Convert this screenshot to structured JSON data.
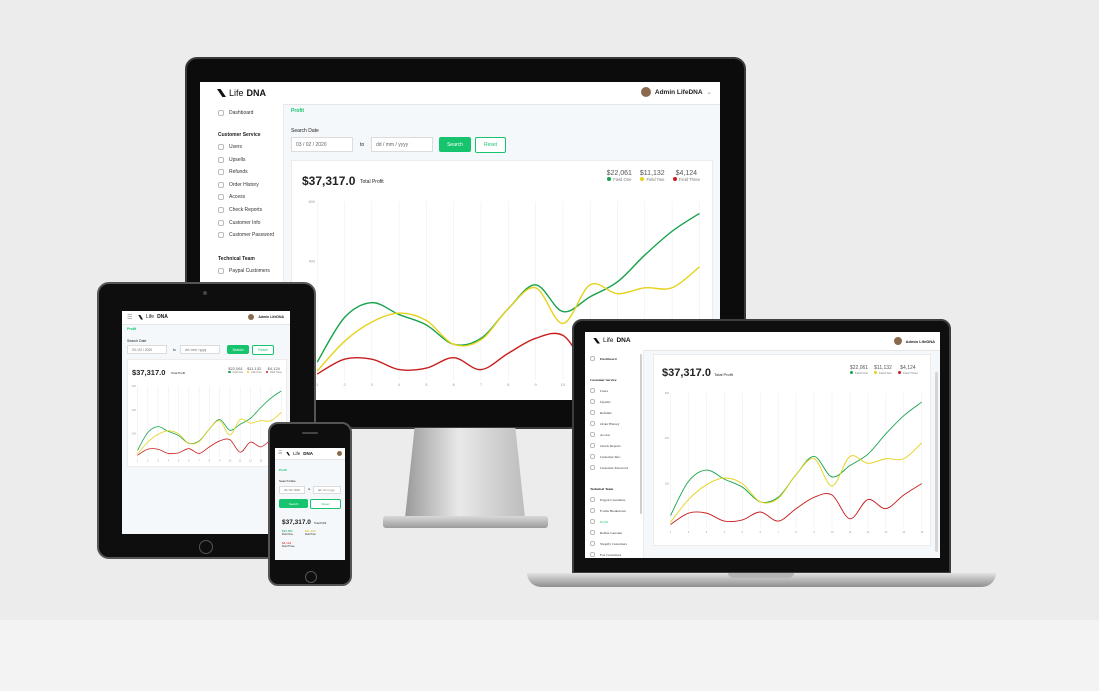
{
  "brand": {
    "prefix": "Life",
    "suffix": "DNA"
  },
  "user": {
    "name": "Admin LifeDNA"
  },
  "sidebar": {
    "dashboard": "Dashboard",
    "customer_service_title": "Customer Service",
    "customer_service_items": [
      "Users",
      "Upsells",
      "Refunds",
      "Order History",
      "Access",
      "Check Reports",
      "Customer Info",
      "Customer Password"
    ],
    "technical_team_title": "Technical Team",
    "technical_team_items": [
      "Paypal Customers",
      "Forms Breakdown",
      "Profit",
      "Refine Genome",
      "Shopify Customers",
      "Fax Customers"
    ]
  },
  "page": {
    "title": "Profit"
  },
  "filters": {
    "label": "Search Date",
    "from_value": "03 / 02 / 2020",
    "to_label": "to",
    "to_placeholder": "dd / mm / yyyy",
    "search_label": "Search",
    "reset_label": "Reset"
  },
  "summary": {
    "total": "$37,317.0",
    "total_label": "Total Profit",
    "stats": [
      {
        "value": "$22,061",
        "label": "Field One",
        "color": "#16a34a"
      },
      {
        "value": "$11,132",
        "label": "Field Two",
        "color": "#e6d21b"
      },
      {
        "value": "$4,124",
        "label": "Field Three",
        "color": "#c81e1e"
      }
    ]
  },
  "chart_data": {
    "type": "line",
    "title": "",
    "y_tick_labels": [
      "600",
      "400",
      "200"
    ],
    "x": [
      1,
      2,
      3,
      4,
      5,
      6,
      7,
      8,
      9,
      10,
      11,
      12,
      13,
      14,
      15
    ],
    "series": [
      {
        "name": "Field One",
        "color": "#16a34a",
        "values": [
          60,
          210,
          260,
          220,
          185,
          120,
          140,
          240,
          320,
          230,
          280,
          330,
          420,
          500,
          560
        ]
      },
      {
        "name": "Field Two",
        "color": "#e6d21b",
        "values": [
          30,
          130,
          195,
          225,
          200,
          120,
          135,
          240,
          310,
          190,
          320,
          290,
          310,
          310,
          380
        ]
      },
      {
        "name": "Field Three",
        "color": "#c81e1e",
        "values": [
          20,
          70,
          70,
          35,
          40,
          75,
          35,
          90,
          140,
          150,
          45,
          130,
          90,
          150,
          200
        ]
      }
    ]
  }
}
